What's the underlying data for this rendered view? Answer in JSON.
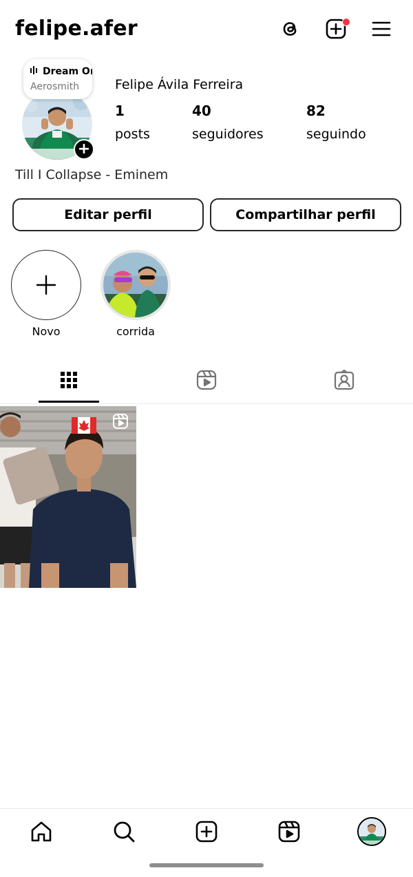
{
  "header": {
    "username": "felipe.afer",
    "notification_dot_color": "#ff3040"
  },
  "profile": {
    "note": {
      "title": "Dream On",
      "artist": "Aerosmith"
    },
    "full_name": "Felipe Ávila Ferreira",
    "stats": {
      "posts": {
        "count": "1",
        "label": "posts"
      },
      "followers": {
        "count": "40",
        "label": "seguidores"
      },
      "following": {
        "count": "82",
        "label": "seguindo"
      }
    },
    "bio": "Till I Collapse - Eminem"
  },
  "buttons": {
    "edit_profile": "Editar perfil",
    "share_profile": "Compartilhar perfil"
  },
  "highlights": [
    {
      "label": "Novo",
      "icon": "plus-icon"
    },
    {
      "label": "corrida",
      "icon": "highlight-cover"
    }
  ],
  "tabs": [
    {
      "name": "grid",
      "icon": "grid-icon",
      "active": true
    },
    {
      "name": "reels",
      "icon": "reels-icon",
      "active": false
    },
    {
      "name": "tagged",
      "icon": "tagged-person-icon",
      "active": false
    }
  ],
  "posts": [
    {
      "type": "reel",
      "overlay_emoji": "🇨🇦"
    }
  ],
  "bottom_nav": [
    {
      "icon": "home-icon"
    },
    {
      "icon": "search-icon"
    },
    {
      "icon": "create-icon"
    },
    {
      "icon": "reels-icon"
    },
    {
      "icon": "profile-avatar"
    }
  ]
}
